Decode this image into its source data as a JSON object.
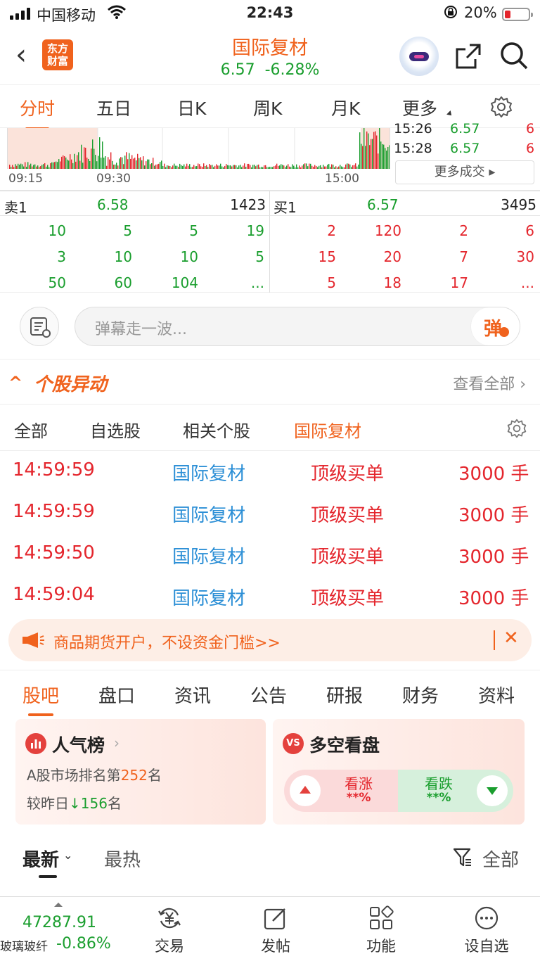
{
  "status_bar": {
    "carrier": "中国移动",
    "time": "22:43",
    "battery": "20%"
  },
  "header": {
    "logo_text": "东方财富",
    "stock_name": "国际复材",
    "price": "6.57",
    "change_pct": "-6.28%"
  },
  "chart_tabs": {
    "items": [
      "分时",
      "五日",
      "日K",
      "周K",
      "月K",
      "更多"
    ],
    "active": "分时"
  },
  "chart": {
    "time_labels": [
      "09:15",
      "09:30",
      "15:00"
    ],
    "recent_trades": [
      {
        "time": "15:26",
        "price": "6.57",
        "volume": "6"
      },
      {
        "time": "15:28",
        "price": "6.57",
        "volume": "6"
      }
    ],
    "more_trades_label": "更多成交"
  },
  "order_book": {
    "sell1": {
      "label": "卖1",
      "price": "6.58",
      "volume": "1423"
    },
    "buy1": {
      "label": "买1",
      "price": "6.57",
      "volume": "3495"
    },
    "sell_queue": [
      [
        "10",
        "5",
        "5",
        "19"
      ],
      [
        "3",
        "10",
        "10",
        "5"
      ],
      [
        "50",
        "60",
        "104",
        "..."
      ]
    ],
    "buy_queue": [
      [
        "2",
        "120",
        "2",
        "6"
      ],
      [
        "15",
        "20",
        "7",
        "30"
      ],
      [
        "5",
        "18",
        "17",
        "..."
      ]
    ]
  },
  "danmu": {
    "placeholder": "弹幕走一波...",
    "send_label": "弹"
  },
  "movement": {
    "title": "个股异动",
    "view_all": "查看全部",
    "tabs": [
      "全部",
      "自选股",
      "相关个股",
      "国际复材"
    ],
    "active_tab": "国际复材",
    "rows": [
      {
        "time": "14:59:59",
        "stock": "国际复材",
        "type": "顶级买单",
        "amount": "3000 手"
      },
      {
        "time": "14:59:59",
        "stock": "国际复材",
        "type": "顶级买单",
        "amount": "3000 手"
      },
      {
        "time": "14:59:50",
        "stock": "国际复材",
        "type": "顶级买单",
        "amount": "3000 手"
      },
      {
        "time": "14:59:04",
        "stock": "国际复材",
        "type": "顶级买单",
        "amount": "3000 手"
      }
    ]
  },
  "ad": {
    "text": "商品期货开户，不设资金门槛>>"
  },
  "content_tabs": {
    "items": [
      "股吧",
      "盘口",
      "资讯",
      "公告",
      "研报",
      "财务",
      "资料"
    ],
    "active": "股吧"
  },
  "popularity_card": {
    "title": "人气榜",
    "rank_prefix": "A股市场排名第",
    "rank": "252",
    "rank_suffix": "名",
    "change_prefix": "较昨日",
    "change_value": "156",
    "change_suffix": "名"
  },
  "vs_card": {
    "icon_text": "VS",
    "title": "多空看盘",
    "bull_label": "看涨",
    "bull_value": "**%",
    "bear_label": "看跌",
    "bear_value": "**%"
  },
  "feed": {
    "latest": "最新",
    "hot": "最热",
    "filter": "全部"
  },
  "bottom_nav": {
    "index_value": "47287.91",
    "index_name": "玻璃玻纤",
    "index_change": "-0.86%",
    "items": [
      "交易",
      "发帖",
      "功能",
      "设自选"
    ]
  },
  "colors": {
    "accent": "#f0621d",
    "up": "#e4262d",
    "down": "#1a9e2e",
    "link": "#2c8fd6"
  }
}
